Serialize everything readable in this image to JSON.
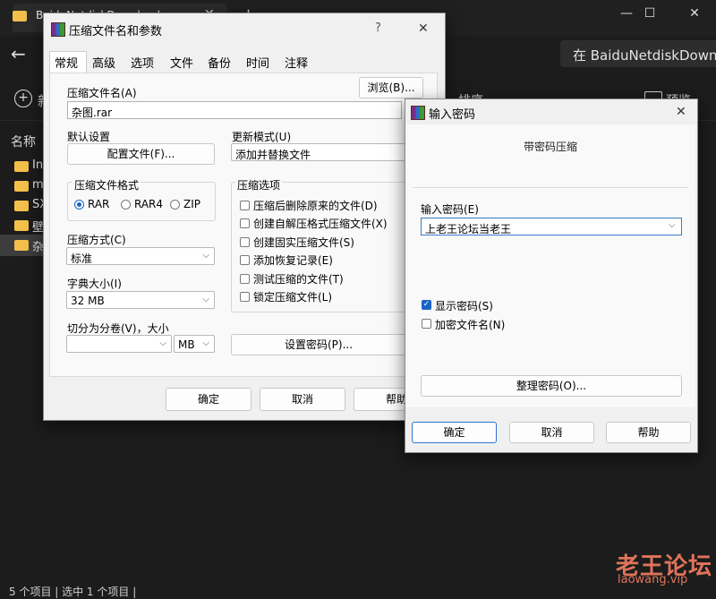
{
  "explorer": {
    "tab_title": "BaiduNetdiskDownload",
    "search_placeholder": "在 BaiduNetdiskDownloa",
    "toolbar_new": "新",
    "toolbar_mid": "排序",
    "toolbar_right": "预览",
    "column_name": "名称",
    "rows": [
      "In",
      "m",
      "SX",
      "壁",
      "杂"
    ],
    "status": "5 个项目  |  选中 1 个项目  |",
    "window_controls": [
      "—",
      "☐",
      "✕"
    ]
  },
  "archive_dialog": {
    "title": "压缩文件名和参数",
    "help_glyph": "?",
    "close_glyph": "✕",
    "tabs": [
      "常规",
      "高级",
      "选项",
      "文件",
      "备份",
      "时间",
      "注释"
    ],
    "archive_name_label": "压缩文件名(A)",
    "browse_button": "浏览(B)...",
    "archive_name_value": "杂图.rar",
    "default_settings_label": "默认设置",
    "profiles_button": "配置文件(F)...",
    "update_mode_label": "更新模式(U)",
    "update_mode_value": "添加并替换文件",
    "format_group_label": "压缩文件格式",
    "formats": [
      "RAR",
      "RAR4",
      "ZIP"
    ],
    "options_group_label": "压缩选项",
    "options": [
      "压缩后删除原来的文件(D)",
      "创建自解压格式压缩文件(X)",
      "创建固实压缩文件(S)",
      "添加恢复记录(E)",
      "测试压缩的文件(T)",
      "锁定压缩文件(L)"
    ],
    "method_label": "压缩方式(C)",
    "method_value": "标准",
    "dict_label": "字典大小(I)",
    "dict_value": "32 MB",
    "split_label": "切分为分卷(V)，大小",
    "split_unit": "MB",
    "set_password_button": "设置密码(P)...",
    "ok_button": "确定",
    "cancel_button": "取消",
    "help_button": "帮助"
  },
  "password_dialog": {
    "title": "输入密码",
    "close_glyph": "✕",
    "heading": "带密码压缩",
    "password_label": "输入密码(E)",
    "password_value": "上老王论坛当老王",
    "show_password_label": "显示密码(S)",
    "encrypt_names_label": "加密文件名(N)",
    "organize_button": "整理密码(O)...",
    "ok_button": "确定",
    "cancel_button": "取消",
    "help_button": "帮助"
  },
  "watermark": {
    "main": "老王论坛",
    "sub": "laowang.vip"
  },
  "colors": {
    "accent": "#1a64c8",
    "watermark": "#e0745a",
    "folder": "#f3c04b"
  }
}
